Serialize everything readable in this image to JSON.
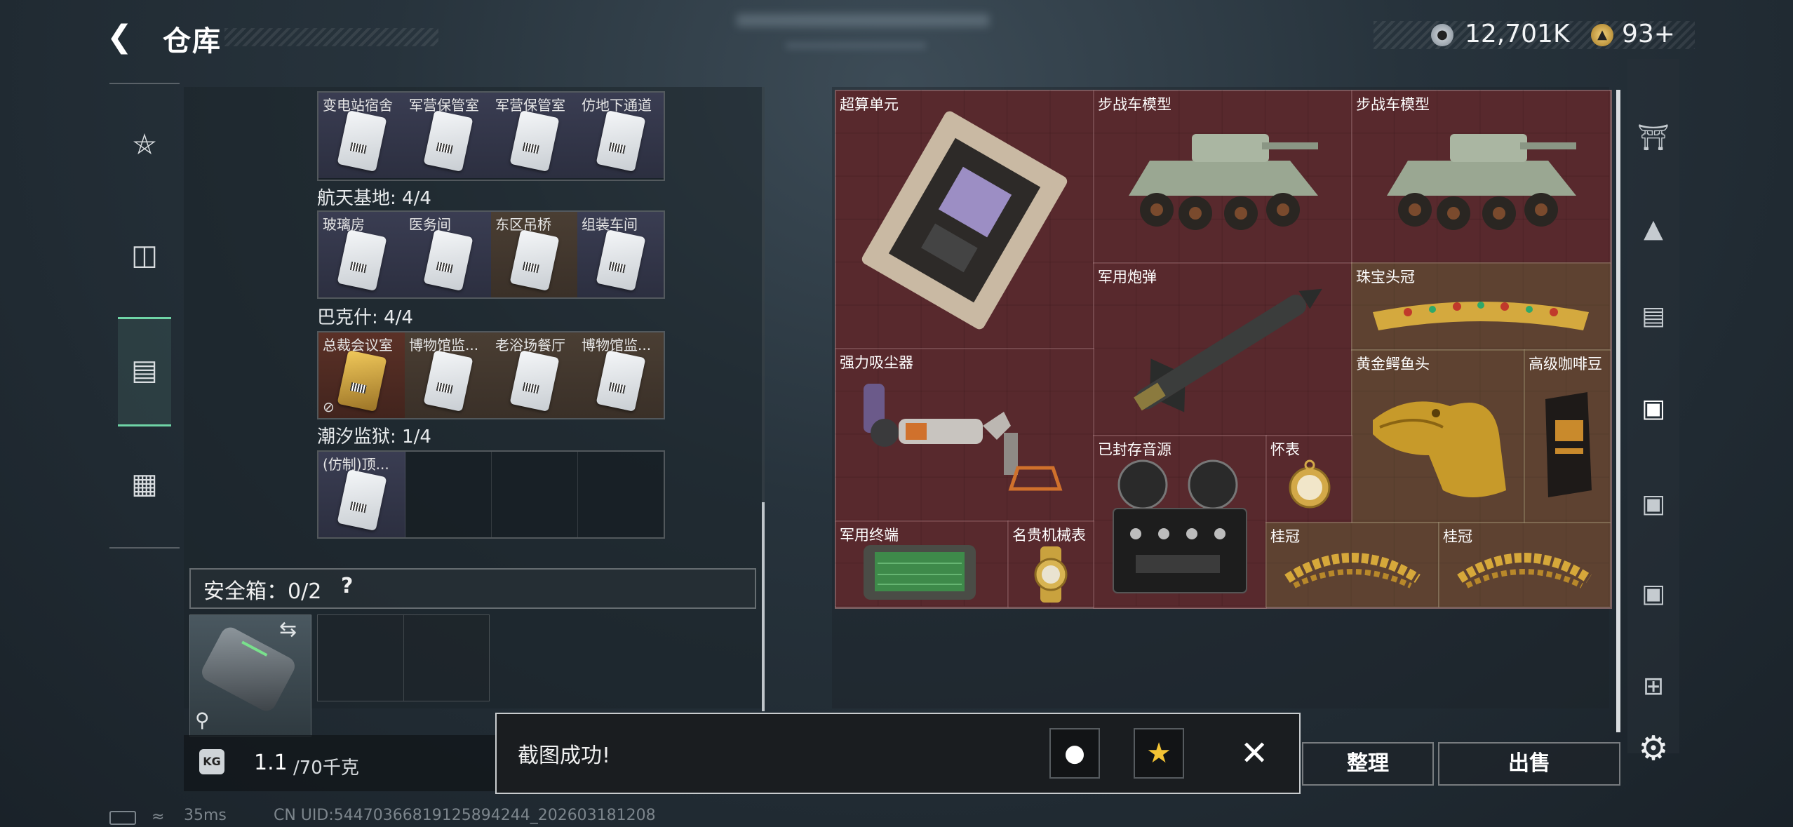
{
  "header": {
    "back_icon": "back-arrow-icon",
    "title": "仓库"
  },
  "currency": [
    {
      "icon": "silver-coin-icon",
      "value": "12,701K"
    },
    {
      "icon": "gold-coin-icon",
      "value": "93+"
    }
  ],
  "left_nav": [
    {
      "icon": "pistol-icon"
    },
    {
      "icon": "backpack-icon"
    },
    {
      "icon": "keycard-case-icon",
      "active": true
    },
    {
      "icon": "toolbox-icon"
    }
  ],
  "keycard_sections": [
    {
      "label": "",
      "slots": [
        {
          "name": "变电站宿舍",
          "color": "purple"
        },
        {
          "name": "军营保管室",
          "color": "purple"
        },
        {
          "name": "军营保管室",
          "color": "purple"
        },
        {
          "name": "仿地下通道",
          "color": "purple"
        }
      ]
    },
    {
      "label": "航天基地: 4/4",
      "slots": [
        {
          "name": "玻璃房",
          "color": "purple"
        },
        {
          "name": "医务间",
          "color": "purple"
        },
        {
          "name": "东区吊桥",
          "color": "brown"
        },
        {
          "name": "组装车间",
          "color": "purple"
        }
      ]
    },
    {
      "label": "巴克什: 4/4",
      "slots": [
        {
          "name": "总裁会议室",
          "color": "red",
          "gold": true,
          "no_store": true
        },
        {
          "name": "博物馆监...",
          "color": "brown"
        },
        {
          "name": "老浴场餐厅",
          "color": "brown"
        },
        {
          "name": "博物馆监...",
          "color": "brown"
        }
      ]
    },
    {
      "label": "潮汐监狱: 1/4",
      "slots": [
        {
          "name": "(仿制)顶...",
          "color": "purple"
        },
        {
          "name": "",
          "color": ""
        },
        {
          "name": "",
          "color": ""
        },
        {
          "name": "",
          "color": ""
        }
      ]
    }
  ],
  "safe_box": {
    "label": "安全箱：0/2",
    "help": "?",
    "swap_icon": "swap-icon",
    "lock_icon": "lock-icon"
  },
  "weight": {
    "icon_label": "KG",
    "current": "1.1",
    "max": "/70千克"
  },
  "items": [
    {
      "name": "超算单元"
    },
    {
      "name": "步战车模型"
    },
    {
      "name": "步战车模型"
    },
    {
      "name": "军用炮弹"
    },
    {
      "name": "珠宝头冠"
    },
    {
      "name": "强力吸尘器"
    },
    {
      "name": "黄金鳄鱼头"
    },
    {
      "name": "高级咖啡豆"
    },
    {
      "name": "已封存音源"
    },
    {
      "name": "怀表"
    },
    {
      "name": "军用终端"
    },
    {
      "name": "名贵机械表"
    },
    {
      "name": "桂冠"
    },
    {
      "name": "桂冠"
    }
  ],
  "buttons": {
    "sort": "整理",
    "sell": "出售"
  },
  "right_nav": [
    {
      "icon": "vault-icon"
    },
    {
      "icon": "tier3-armor-icon"
    },
    {
      "icon": "tier3-rig-icon"
    },
    {
      "icon": "tier4-case-icon"
    },
    {
      "icon": "tier4-case-icon"
    },
    {
      "icon": "tier3-case-icon"
    },
    {
      "icon": "tier2-add-icon"
    }
  ],
  "toast": {
    "message": "截图成功!",
    "share_qq": "qq-icon",
    "share_qzone": "qzone-star-icon",
    "close": "close-icon"
  },
  "status_bar": {
    "ping": "35ms",
    "uid": "CN UID:5447036681912589424​4_202603181208"
  }
}
